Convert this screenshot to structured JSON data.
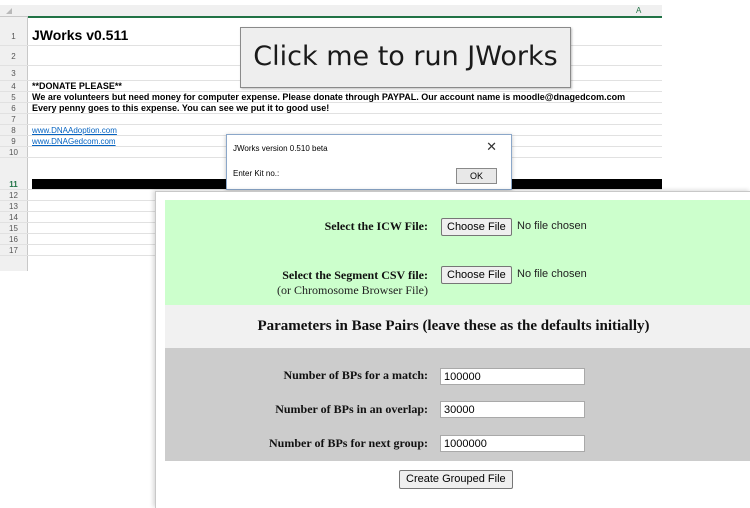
{
  "spreadsheet": {
    "column_header": "A",
    "rows": [
      {
        "num": "1",
        "text": "JWorks v0.511"
      },
      {
        "num": "2",
        "text": ""
      },
      {
        "num": "3",
        "text": ""
      },
      {
        "num": "4",
        "text": "**DONATE PLEASE**"
      },
      {
        "num": "5",
        "text": "We are volunteers but need money for computer expense. Please donate through PAYPAL. Our account name is moodle@dnagedcom.com"
      },
      {
        "num": "6",
        "text": "Every penny goes to this expense. You can see we put it to good use!"
      },
      {
        "num": "7",
        "text": ""
      },
      {
        "num": "8",
        "text": "www.DNAAdoption.com"
      },
      {
        "num": "9",
        "text": "www.DNAGedcom.com"
      },
      {
        "num": "10",
        "text": ""
      },
      {
        "num": "11",
        "text": ""
      },
      {
        "num": "12",
        "text": ""
      },
      {
        "num": "13",
        "text": ""
      },
      {
        "num": "14",
        "text": ""
      },
      {
        "num": "15",
        "text": ""
      },
      {
        "num": "16",
        "text": ""
      },
      {
        "num": "17",
        "text": ""
      }
    ],
    "run_button_label": "Click me to run JWorks"
  },
  "dialog": {
    "title": "JWorks version 0.510 beta",
    "close_glyph": "✕",
    "prompt": "Enter Kit no.:",
    "ok_label": "OK"
  },
  "form": {
    "icw_label": "Select the ICW File:",
    "segment_label": "Select the Segment CSV file:",
    "segment_sublabel": "(or Chromosome Browser File)",
    "choose_file_label": "Choose File",
    "no_file_text": "No file chosen",
    "params_heading": "Parameters in Base Pairs (leave these as the defaults initially)",
    "fields": [
      {
        "label": "Number of BPs for a match:",
        "value": "100000"
      },
      {
        "label": "Number of BPs in an overlap:",
        "value": "30000"
      },
      {
        "label": "Number of BPs for next group:",
        "value": "1000000"
      }
    ],
    "submit_label": "Create Grouped File"
  },
  "colors": {
    "excel_green": "#217346",
    "link_blue": "#0563c1",
    "form_green": "#ccffcc",
    "form_gray": "#cccccc"
  }
}
